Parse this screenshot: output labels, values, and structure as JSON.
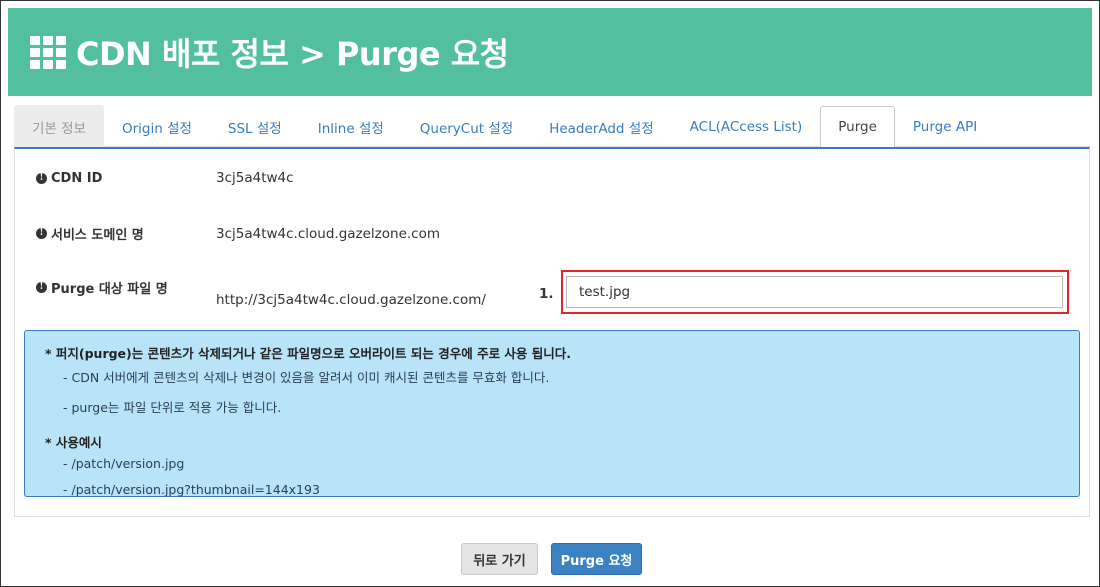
{
  "header": {
    "title": "CDN 배포 정보 > Purge 요청",
    "icon": "grid-icon"
  },
  "tabs": [
    {
      "label": "기본 정보"
    },
    {
      "label": "Origin 설정"
    },
    {
      "label": "SSL 설정"
    },
    {
      "label": "Inline 설정"
    },
    {
      "label": "QueryCut 설정"
    },
    {
      "label": "HeaderAdd 설정"
    },
    {
      "label": "ACL(ACcess List)"
    },
    {
      "label": "Purge"
    },
    {
      "label": "Purge API"
    }
  ],
  "fields": {
    "cdn_id": {
      "label": "CDN ID",
      "value": "3cj5a4tw4c"
    },
    "service_domain": {
      "label": "서비스 도메인 명",
      "value": "3cj5a4tw4c.cloud.gazelzone.com"
    },
    "purge_file": {
      "label": "Purge 대상 파일 명",
      "prefix": "http://3cj5a4tw4c.cloud.gazelzone.com/",
      "step": "1.",
      "input_value": "test.jpg"
    }
  },
  "note": {
    "heading1": "* 퍼지(purge)는 콘텐츠가 삭제되거나 같은 파일명으로 오버라이트 되는 경우에 주로 사용 됩니다.",
    "line1": "- CDN 서버에게 콘텐츠의 삭제나 변경이 있음을 알려서 이미 캐시된 콘텐츠를 무효화 합니다.",
    "line2": "- purge는 파일 단위로 적용 가능 합니다.",
    "heading2": "* 사용예시",
    "ex1": "- /patch/version.jpg",
    "ex2": "- /patch/version.jpg?thumbnail=144x193"
  },
  "buttons": {
    "back": "뒤로 가기",
    "purge": "Purge 요청"
  },
  "colors": {
    "header": "#52c09e",
    "accent": "#3a7cc0",
    "note_bg": "#b9e3f6",
    "highlight": "#e0262a"
  }
}
